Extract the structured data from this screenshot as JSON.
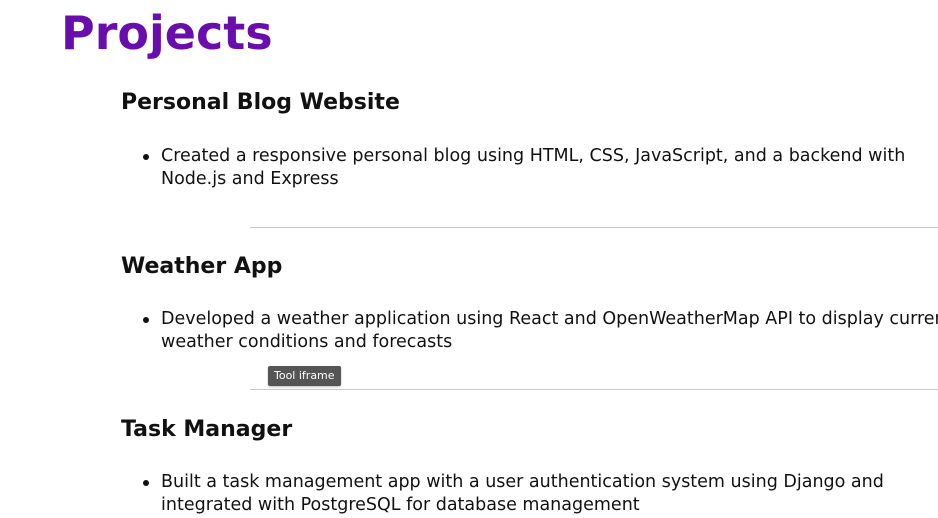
{
  "page": {
    "title": "Projects",
    "title_color": "#6a0dad"
  },
  "projects": [
    {
      "title": "Personal Blog Website",
      "bullet_lines": [
        "Created a responsive personal blog using HTML, CSS, JavaScript, and a backend with",
        "Node.js and Express"
      ]
    },
    {
      "title": "Weather App",
      "bullet_lines": [
        "Developed a weather application using React and OpenWeatherMap API to display current",
        "weather conditions and forecasts"
      ]
    },
    {
      "title": "Task Manager",
      "bullet_lines": [
        "Built a task management app with a user authentication system using Django and",
        "integrated with PostgreSQL for database management"
      ]
    }
  ],
  "tooltip": {
    "text": "Tool iframe"
  }
}
